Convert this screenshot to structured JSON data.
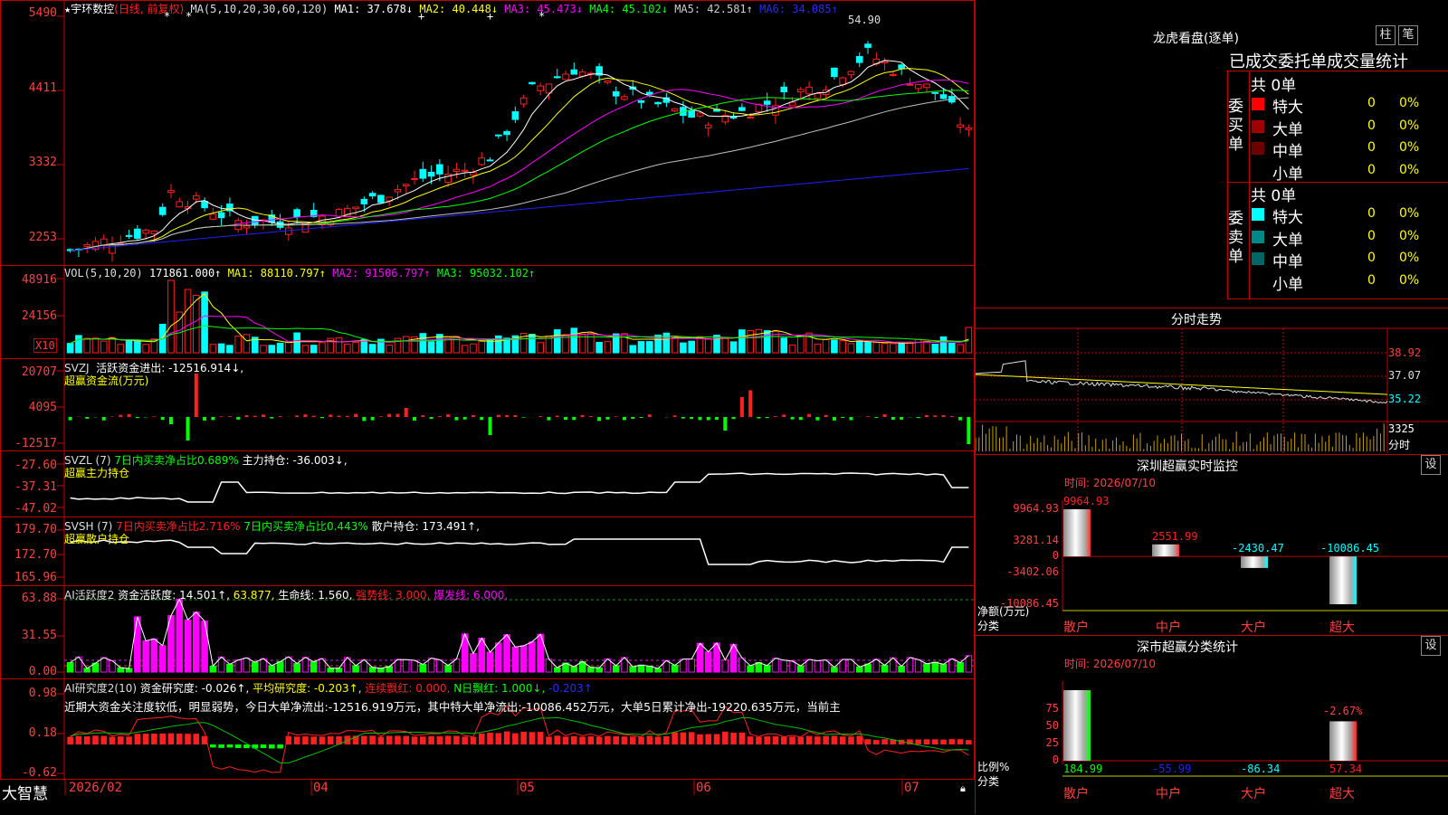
{
  "colors": {
    "up": "#ff2020",
    "down": "#00ffff",
    "bg": "#000000",
    "border": "#c00000",
    "ma1": "#ffffff",
    "ma2": "#ffff00",
    "ma3": "#ff00ff",
    "ma4": "#00ff00",
    "ma5": "#c0c0c0",
    "ma6": "#2020ff"
  },
  "kline": {
    "title_star": "★",
    "name": "宇环数控",
    "period": "(日线, 前复权)",
    "ma_prefix": "MA(5,10,20,30,60,120)",
    "ma": [
      {
        "label": "MA1: 37.678↓",
        "color": "#ffffff"
      },
      {
        "label": "MA2: 40.448↓",
        "color": "#ffff00"
      },
      {
        "label": "MA3: 45.473↓",
        "color": "#ff00ff"
      },
      {
        "label": "MA4: 45.102↓",
        "color": "#00ff00"
      },
      {
        "label": "MA5: 42.581↑",
        "color": "#c0c0c0"
      },
      {
        "label": "MA6: 34.085↑",
        "color": "#2020ff"
      }
    ],
    "y_ticks": [
      "5490",
      "4411",
      "3332",
      "2253"
    ],
    "high_label": "54.90",
    "markers": [
      "*",
      "*",
      "+",
      "+",
      "*"
    ]
  },
  "vol": {
    "title": "VOL(5,10,20)",
    "value": "171861.000↑",
    "ma": [
      {
        "label": "MA1: 88110.797↑",
        "color": "#ffff00"
      },
      {
        "label": "MA2: 91506.797↑",
        "color": "#ff00ff"
      },
      {
        "label": "MA3: 95032.102↑",
        "color": "#00ff00"
      }
    ],
    "y_ticks": [
      "48916",
      "24156"
    ],
    "unit": "X10"
  },
  "svzj": {
    "title": "SVZJ",
    "line1": "活跃资金进出: -12516.914↓,",
    "line2": "超赢资金流(万元)",
    "y_ticks": [
      "20707",
      "4095",
      "-12517"
    ]
  },
  "svzl": {
    "title": "SVZL (7)",
    "seg1": "7日内买卖净占比0.689%",
    "seg2": "主力持仓: -36.003↓,",
    "line2": "超赢主力持仓",
    "y_ticks": [
      "-27.60",
      "-37.31",
      "-47.02"
    ]
  },
  "svsh": {
    "title": "SVSH (7)",
    "seg1": "7日内买卖净占比2.716%",
    "seg2": "7日内买卖净占比0.443%",
    "seg3": "散户持仓: 173.491↑,",
    "line2": "超赢散户持仓",
    "y_ticks": [
      "179.70",
      "172.70",
      "165.96"
    ]
  },
  "ai1": {
    "title": "AI活跃度2",
    "seg1": "资金活跃度: 14.501↑,",
    "seg2": "63.877,",
    "seg3": "生命线: 1.560,",
    "seg4": "强势线: 3.000,",
    "seg5": "爆发线: 6.000,",
    "y_ticks": [
      "63.88",
      "31.55",
      "0.00"
    ]
  },
  "ai2": {
    "title": "AI研究度2(10)",
    "seg1": "资金研究度: -0.026↑,",
    "seg2": "平均研究度: -0.203↑,",
    "seg3": "连续飘红: 0.000,",
    "seg4": "N日飘红: 1.000↓,",
    "seg5": "-0.203↑",
    "line2": "近期大资金关注度较低，明显弱势，今日大单净流出:-12516.919万元，其中特大单净流出:-10086.452万元，大单5日累计净出-19220.635万元，当前主",
    "y_ticks": [
      "0.98",
      "0.18",
      "-0.62"
    ]
  },
  "xaxis": {
    "brand": "大智慧",
    "labels": [
      "2026/02",
      "04",
      "05",
      "06",
      "07"
    ]
  },
  "dragon": {
    "title": "龙虎看盘(逐单)",
    "btn1": "柱",
    "btn2": "笔",
    "tab_header": "已成交委托单成交量统计",
    "buy": {
      "side": "委买单",
      "total": "共 0单",
      "rows": [
        {
          "name": "特大",
          "v": "0",
          "p": "0%",
          "color": "#ff0000"
        },
        {
          "name": "大单",
          "v": "0",
          "p": "0%",
          "color": "#a00000"
        },
        {
          "name": "中单",
          "v": "0",
          "p": "0%",
          "color": "#700000"
        },
        {
          "name": "小单",
          "v": "0",
          "p": "0%",
          "color": "#000000"
        }
      ]
    },
    "sell": {
      "side": "委卖单",
      "total": "共 0单",
      "rows": [
        {
          "name": "特大",
          "v": "0",
          "p": "0%",
          "color": "#00ffff"
        },
        {
          "name": "大单",
          "v": "0",
          "p": "0%",
          "color": "#008888"
        },
        {
          "name": "中单",
          "v": "0",
          "p": "0%",
          "color": "#006666"
        },
        {
          "name": "小单",
          "v": "0",
          "p": "0%",
          "color": "#000000"
        }
      ]
    }
  },
  "intraday": {
    "title": "分时走势",
    "y_ticks": [
      "38.92",
      "37.07",
      "35.22",
      "3325"
    ],
    "unit": "分时"
  },
  "monitor": {
    "title": "深圳超赢实时监控",
    "btn": "设",
    "time": "时间: 2026/07/10",
    "y_ticks": [
      "9964.93",
      "3281.14",
      "0",
      "-3402.06",
      "-10086.45"
    ],
    "ylabel": "净额(万元)",
    "xlabel": "分类",
    "bars": [
      {
        "cat": "散户",
        "value": 9964.93,
        "label": "9964.93",
        "lcolor": "#ff2020"
      },
      {
        "cat": "中户",
        "value": 2551.99,
        "label": "2551.99",
        "lcolor": "#ff2020"
      },
      {
        "cat": "大户",
        "value": -2430.47,
        "label": "-2430.47",
        "lcolor": "#00ffff"
      },
      {
        "cat": "超大",
        "value": -10086.45,
        "label": "-10086.45",
        "lcolor": "#00ffff"
      }
    ]
  },
  "cls": {
    "title": "深市超赢分类统计",
    "btn": "设",
    "time": "时间: 2026/07/10",
    "y_ticks": [
      "75",
      "50",
      "25",
      "0"
    ],
    "ylabel": "比例%",
    "xlabel": "分类",
    "bars": [
      {
        "cat": "散户",
        "value": 184.99,
        "label": "184.99",
        "lcolor": "#00ff00"
      },
      {
        "cat": "中户",
        "value": -55.99,
        "label": "-55.99",
        "lcolor": "#2020ff"
      },
      {
        "cat": "大户",
        "value": -86.34,
        "label": "-86.34",
        "lcolor": "#00ffff"
      },
      {
        "cat": "超大",
        "value": 57.34,
        "label": "57.34",
        "lcolor": "#ff2020",
        "top": "-2.67%"
      }
    ]
  }
}
